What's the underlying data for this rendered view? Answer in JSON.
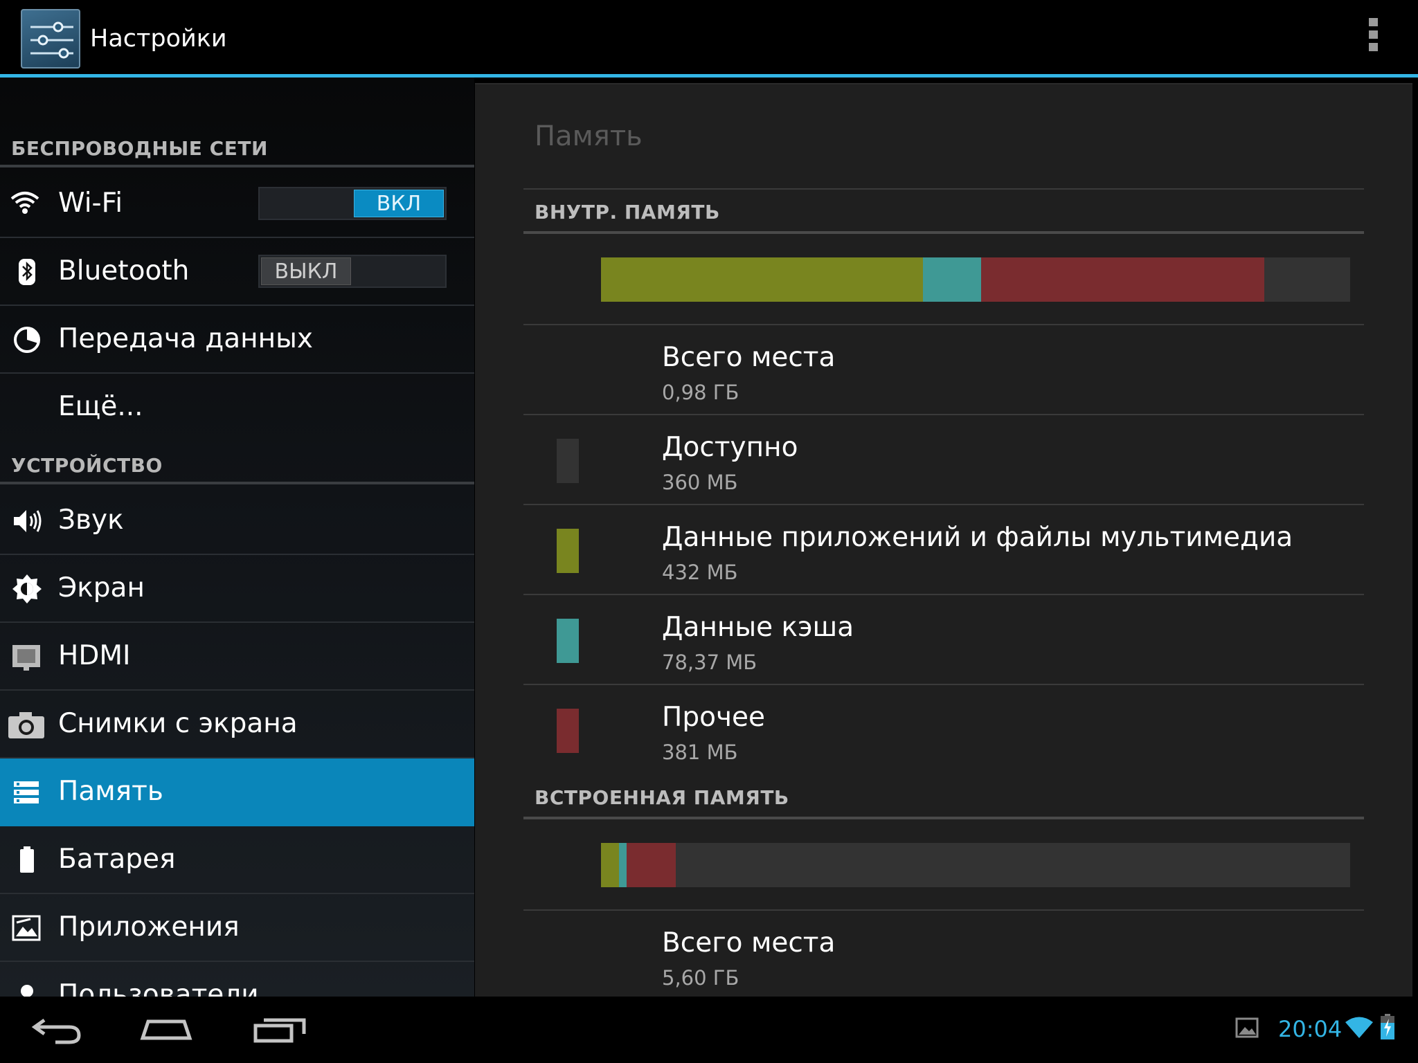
{
  "action_bar": {
    "title": "Настройки",
    "icon": "settings-sliders-icon",
    "overflow_icon": "overflow-menu-icon"
  },
  "sidebar": {
    "sections": [
      {
        "header": "БЕСПРОВОДНЫЕ СЕТИ",
        "items": [
          {
            "label": "Wi-Fi",
            "icon": "wifi-icon",
            "toggle": "ВКЛ",
            "toggle_state": "on"
          },
          {
            "label": "Bluetooth",
            "icon": "bluetooth-icon",
            "toggle": "ВЫКЛ",
            "toggle_state": "off"
          },
          {
            "label": "Передача данных",
            "icon": "data-usage-icon"
          },
          {
            "label": "Ещё..."
          }
        ]
      },
      {
        "header": "УСТРОЙСТВО",
        "items": [
          {
            "label": "Звук",
            "icon": "sound-icon"
          },
          {
            "label": "Экран",
            "icon": "brightness-icon"
          },
          {
            "label": "HDMI",
            "icon": "hdmi-icon"
          },
          {
            "label": "Снимки с экрана",
            "icon": "camera-icon"
          },
          {
            "label": "Память",
            "icon": "storage-icon",
            "selected": true
          },
          {
            "label": "Батарея",
            "icon": "battery-icon"
          },
          {
            "label": "Приложения",
            "icon": "apps-icon"
          },
          {
            "label": "Пользователи",
            "icon": "users-icon"
          }
        ]
      }
    ]
  },
  "content": {
    "title": "Память",
    "internal": {
      "header": "ВНУТР. ПАМЯТЬ",
      "total_label": "Всего места",
      "total_value": "0,98 ГБ",
      "items": [
        {
          "label": "Доступно",
          "value": "360 МБ",
          "color": "#333333"
        },
        {
          "label": "Данные приложений и файлы мультимедиа",
          "value": "432 МБ",
          "color": "#79851f"
        },
        {
          "label": "Данные кэша",
          "value": "78,37 МБ",
          "color": "#3f9995"
        },
        {
          "label": "Прочее",
          "value": "381 МБ",
          "color": "#7a2c2f"
        }
      ],
      "usage_fractions": {
        "apps": 0.43,
        "cache": 0.077,
        "other": 0.378,
        "free": 0.115
      }
    },
    "builtin": {
      "header": "ВСТРОЕННАЯ ПАМЯТЬ",
      "total_label": "Всего места",
      "total_value": "5,60 ГБ",
      "usage_fractions": {
        "apps": 0.024,
        "cache": 0.01,
        "other": 0.066,
        "free": 0.9
      }
    }
  },
  "status_bar": {
    "time": "20:04",
    "icons": [
      "back-icon",
      "home-icon",
      "recent-apps-icon",
      "gallery-notification-icon",
      "wifi-signal-icon",
      "battery-charging-icon"
    ]
  },
  "colors": {
    "accent": "#33b5e5",
    "selected": "#0a86ba",
    "apps": "#79851f",
    "cache": "#3f9995",
    "other": "#7a2c2f",
    "free": "#333333"
  }
}
